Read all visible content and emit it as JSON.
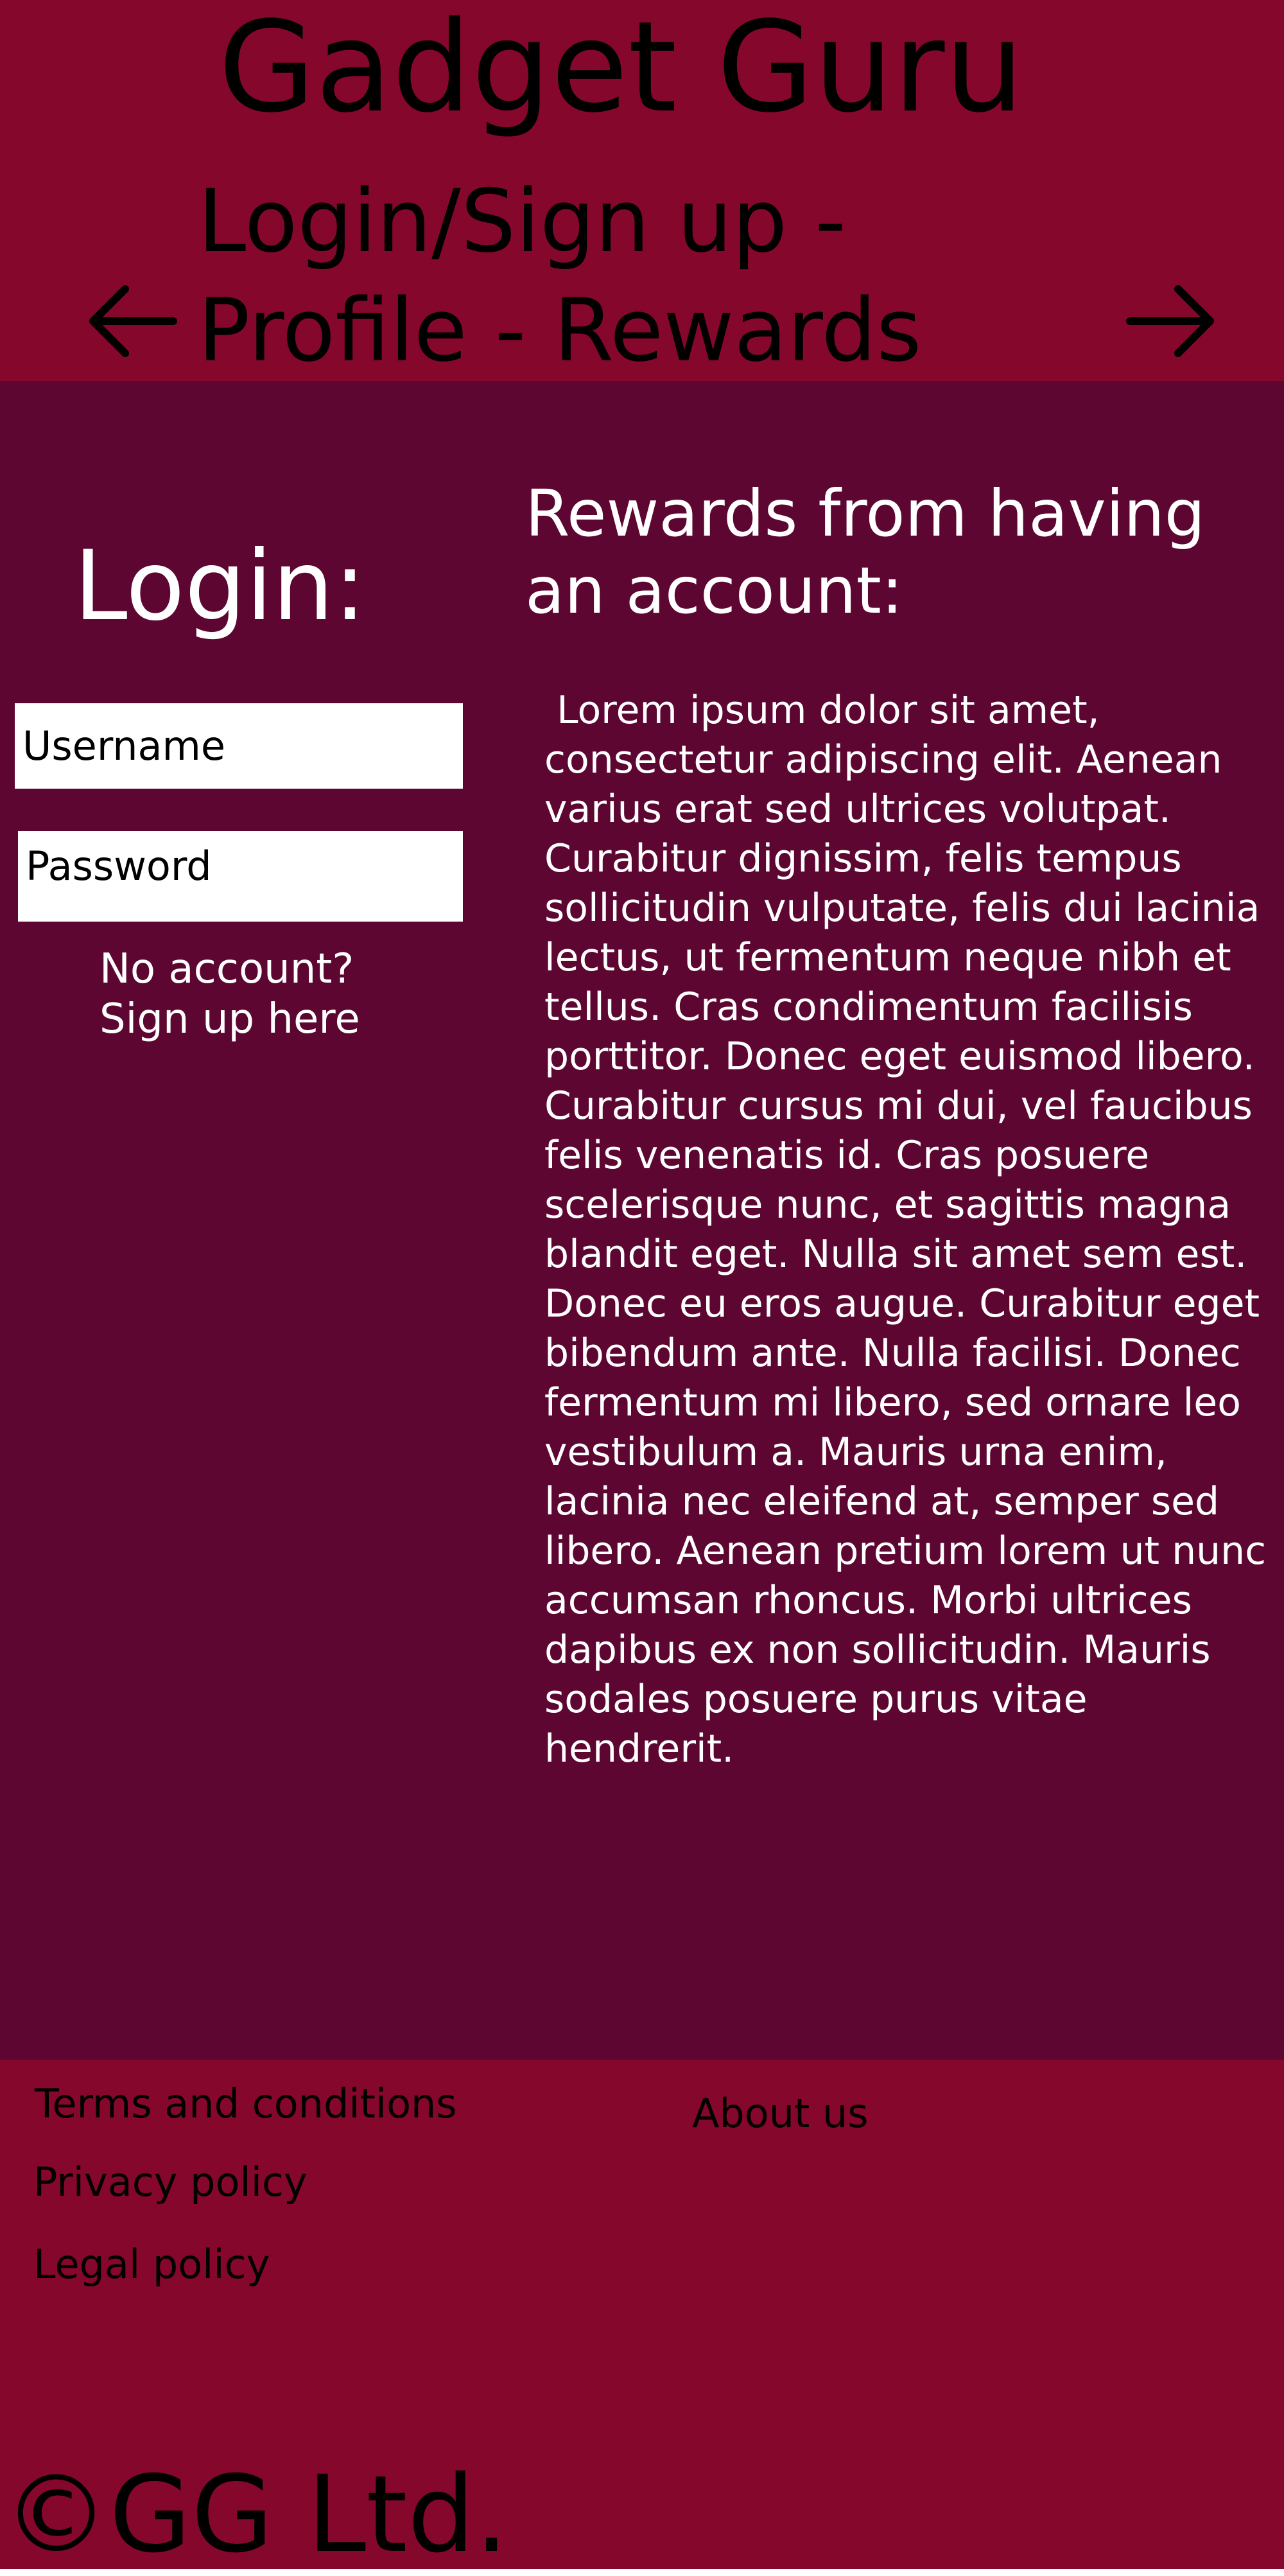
{
  "header": {
    "site_title": "Gadget Guru",
    "nav_text": "Login/Sign up - Profile - Rewards",
    "arrow_left_icon": "arrow-left-icon",
    "arrow_right_icon": "arrow-right-icon"
  },
  "login": {
    "heading": "Login:",
    "username_placeholder": "Username",
    "password_placeholder": "Password",
    "signup_line1": "No account?",
    "signup_line2": "Sign up here"
  },
  "rewards": {
    "heading": "Rewards from having an account:",
    "body": " Lorem ipsum dolor sit amet, consectetur adipiscing elit. Aenean varius erat sed ultrices volutpat. Curabitur dignissim, felis tempus sollicitudin vulputate, felis dui lacinia lectus, ut fermentum neque nibh et tellus. Cras condimentum facilisis porttitor. Donec eget euismod libero. Curabitur cursus mi dui, vel faucibus felis venenatis id. Cras posuere scelerisque nunc, et sagittis magna blandit eget. Nulla sit amet sem est. Donec eu eros augue. Curabitur eget bibendum ante. Nulla facilisi. Donec fermentum mi libero, sed ornare leo vestibulum a. Mauris urna enim, lacinia nec eleifend at, semper sed libero. Aenean pretium lorem ut nunc accumsan rhoncus. Morbi ultrices dapibus ex non sollicitudin. Mauris sodales posuere purus vitae hendrerit."
  },
  "footer": {
    "terms": "Terms and conditions",
    "privacy": "Privacy policy",
    "legal": "Legal policy",
    "about": "About us",
    "copyright": "©GG Ltd."
  },
  "colors": {
    "header_footer_bg": "#85072b",
    "main_bg": "#5d0631",
    "field_bg": "#ffffff",
    "light_text": "#ffffff",
    "dark_text": "#000000"
  }
}
